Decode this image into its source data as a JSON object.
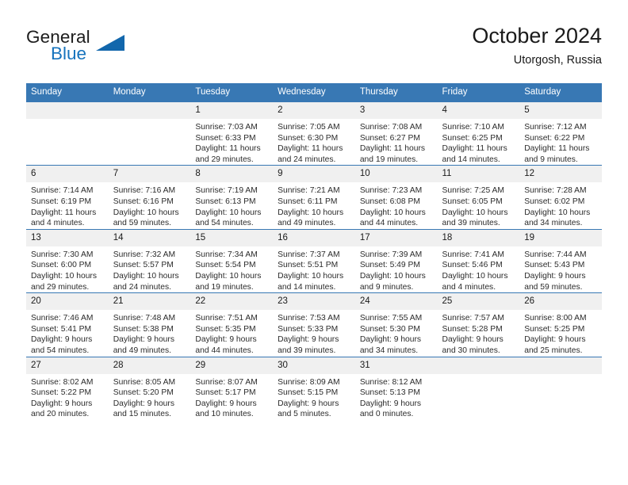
{
  "brand": {
    "word1": "General",
    "word2": "Blue",
    "logo_icon": "blue-triangle-logo",
    "color_primary": "#1267ac",
    "color_text": "#1d1d1d"
  },
  "header": {
    "title": "October 2024",
    "subtitle": "Utorgosh, Russia"
  },
  "theme": {
    "header_bg": "#3878b4",
    "daynum_bg": "#f0f0f0",
    "grid_line": "#3878b4"
  },
  "weekdays": [
    "Sunday",
    "Monday",
    "Tuesday",
    "Wednesday",
    "Thursday",
    "Friday",
    "Saturday"
  ],
  "weeks": [
    [
      {
        "day": "",
        "lines": []
      },
      {
        "day": "",
        "lines": []
      },
      {
        "day": "1",
        "lines": [
          "Sunrise: 7:03 AM",
          "Sunset: 6:33 PM",
          "Daylight: 11 hours",
          "and 29 minutes."
        ]
      },
      {
        "day": "2",
        "lines": [
          "Sunrise: 7:05 AM",
          "Sunset: 6:30 PM",
          "Daylight: 11 hours",
          "and 24 minutes."
        ]
      },
      {
        "day": "3",
        "lines": [
          "Sunrise: 7:08 AM",
          "Sunset: 6:27 PM",
          "Daylight: 11 hours",
          "and 19 minutes."
        ]
      },
      {
        "day": "4",
        "lines": [
          "Sunrise: 7:10 AM",
          "Sunset: 6:25 PM",
          "Daylight: 11 hours",
          "and 14 minutes."
        ]
      },
      {
        "day": "5",
        "lines": [
          "Sunrise: 7:12 AM",
          "Sunset: 6:22 PM",
          "Daylight: 11 hours",
          "and 9 minutes."
        ]
      }
    ],
    [
      {
        "day": "6",
        "lines": [
          "Sunrise: 7:14 AM",
          "Sunset: 6:19 PM",
          "Daylight: 11 hours",
          "and 4 minutes."
        ]
      },
      {
        "day": "7",
        "lines": [
          "Sunrise: 7:16 AM",
          "Sunset: 6:16 PM",
          "Daylight: 10 hours",
          "and 59 minutes."
        ]
      },
      {
        "day": "8",
        "lines": [
          "Sunrise: 7:19 AM",
          "Sunset: 6:13 PM",
          "Daylight: 10 hours",
          "and 54 minutes."
        ]
      },
      {
        "day": "9",
        "lines": [
          "Sunrise: 7:21 AM",
          "Sunset: 6:11 PM",
          "Daylight: 10 hours",
          "and 49 minutes."
        ]
      },
      {
        "day": "10",
        "lines": [
          "Sunrise: 7:23 AM",
          "Sunset: 6:08 PM",
          "Daylight: 10 hours",
          "and 44 minutes."
        ]
      },
      {
        "day": "11",
        "lines": [
          "Sunrise: 7:25 AM",
          "Sunset: 6:05 PM",
          "Daylight: 10 hours",
          "and 39 minutes."
        ]
      },
      {
        "day": "12",
        "lines": [
          "Sunrise: 7:28 AM",
          "Sunset: 6:02 PM",
          "Daylight: 10 hours",
          "and 34 minutes."
        ]
      }
    ],
    [
      {
        "day": "13",
        "lines": [
          "Sunrise: 7:30 AM",
          "Sunset: 6:00 PM",
          "Daylight: 10 hours",
          "and 29 minutes."
        ]
      },
      {
        "day": "14",
        "lines": [
          "Sunrise: 7:32 AM",
          "Sunset: 5:57 PM",
          "Daylight: 10 hours",
          "and 24 minutes."
        ]
      },
      {
        "day": "15",
        "lines": [
          "Sunrise: 7:34 AM",
          "Sunset: 5:54 PM",
          "Daylight: 10 hours",
          "and 19 minutes."
        ]
      },
      {
        "day": "16",
        "lines": [
          "Sunrise: 7:37 AM",
          "Sunset: 5:51 PM",
          "Daylight: 10 hours",
          "and 14 minutes."
        ]
      },
      {
        "day": "17",
        "lines": [
          "Sunrise: 7:39 AM",
          "Sunset: 5:49 PM",
          "Daylight: 10 hours",
          "and 9 minutes."
        ]
      },
      {
        "day": "18",
        "lines": [
          "Sunrise: 7:41 AM",
          "Sunset: 5:46 PM",
          "Daylight: 10 hours",
          "and 4 minutes."
        ]
      },
      {
        "day": "19",
        "lines": [
          "Sunrise: 7:44 AM",
          "Sunset: 5:43 PM",
          "Daylight: 9 hours",
          "and 59 minutes."
        ]
      }
    ],
    [
      {
        "day": "20",
        "lines": [
          "Sunrise: 7:46 AM",
          "Sunset: 5:41 PM",
          "Daylight: 9 hours",
          "and 54 minutes."
        ]
      },
      {
        "day": "21",
        "lines": [
          "Sunrise: 7:48 AM",
          "Sunset: 5:38 PM",
          "Daylight: 9 hours",
          "and 49 minutes."
        ]
      },
      {
        "day": "22",
        "lines": [
          "Sunrise: 7:51 AM",
          "Sunset: 5:35 PM",
          "Daylight: 9 hours",
          "and 44 minutes."
        ]
      },
      {
        "day": "23",
        "lines": [
          "Sunrise: 7:53 AM",
          "Sunset: 5:33 PM",
          "Daylight: 9 hours",
          "and 39 minutes."
        ]
      },
      {
        "day": "24",
        "lines": [
          "Sunrise: 7:55 AM",
          "Sunset: 5:30 PM",
          "Daylight: 9 hours",
          "and 34 minutes."
        ]
      },
      {
        "day": "25",
        "lines": [
          "Sunrise: 7:57 AM",
          "Sunset: 5:28 PM",
          "Daylight: 9 hours",
          "and 30 minutes."
        ]
      },
      {
        "day": "26",
        "lines": [
          "Sunrise: 8:00 AM",
          "Sunset: 5:25 PM",
          "Daylight: 9 hours",
          "and 25 minutes."
        ]
      }
    ],
    [
      {
        "day": "27",
        "lines": [
          "Sunrise: 8:02 AM",
          "Sunset: 5:22 PM",
          "Daylight: 9 hours",
          "and 20 minutes."
        ]
      },
      {
        "day": "28",
        "lines": [
          "Sunrise: 8:05 AM",
          "Sunset: 5:20 PM",
          "Daylight: 9 hours",
          "and 15 minutes."
        ]
      },
      {
        "day": "29",
        "lines": [
          "Sunrise: 8:07 AM",
          "Sunset: 5:17 PM",
          "Daylight: 9 hours",
          "and 10 minutes."
        ]
      },
      {
        "day": "30",
        "lines": [
          "Sunrise: 8:09 AM",
          "Sunset: 5:15 PM",
          "Daylight: 9 hours",
          "and 5 minutes."
        ]
      },
      {
        "day": "31",
        "lines": [
          "Sunrise: 8:12 AM",
          "Sunset: 5:13 PM",
          "Daylight: 9 hours",
          "and 0 minutes."
        ]
      },
      {
        "day": "",
        "lines": []
      },
      {
        "day": "",
        "lines": []
      }
    ]
  ]
}
